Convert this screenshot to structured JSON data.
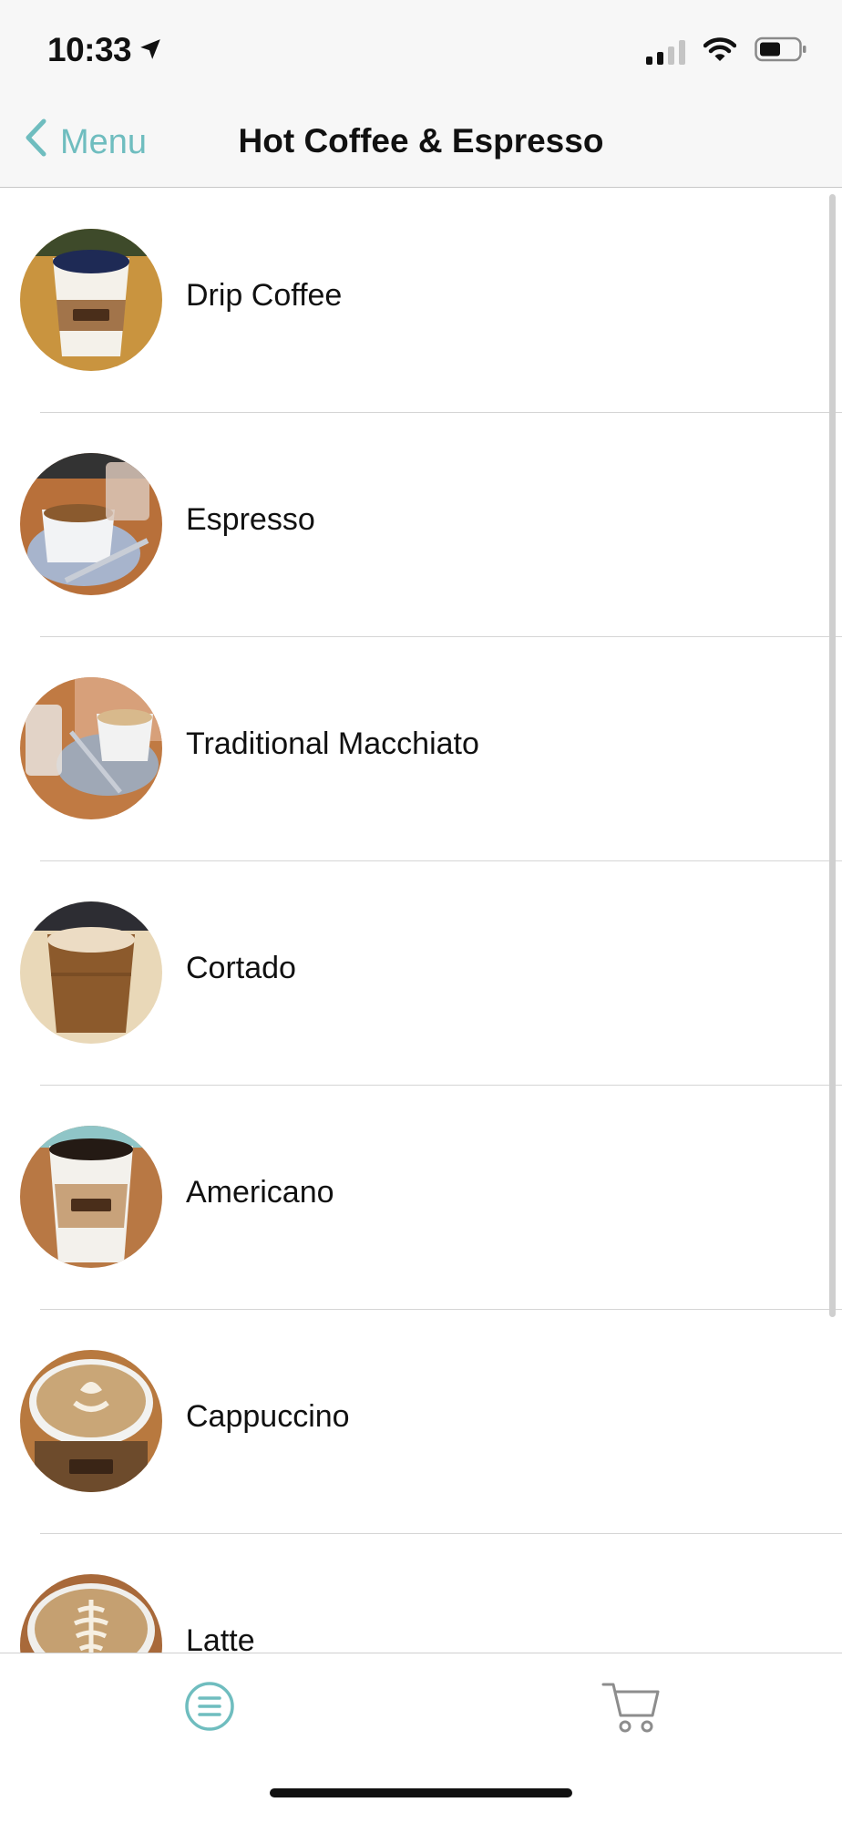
{
  "status_bar": {
    "time": "10:33"
  },
  "nav": {
    "back_label": "Menu",
    "title": "Hot Coffee & Espresso"
  },
  "items": [
    {
      "label": "Drip Coffee",
      "image": "drip-coffee-photo"
    },
    {
      "label": "Espresso",
      "image": "espresso-photo"
    },
    {
      "label": "Traditional Macchiato",
      "image": "macchiato-photo"
    },
    {
      "label": "Cortado",
      "image": "cortado-photo"
    },
    {
      "label": "Americano",
      "image": "americano-photo"
    },
    {
      "label": "Cappuccino",
      "image": "cappuccino-photo"
    },
    {
      "label": "Latte",
      "image": "latte-photo"
    }
  ],
  "tab_bar": {
    "tabs": [
      {
        "icon": "menu-list-icon",
        "active": true
      },
      {
        "icon": "cart-icon",
        "active": false
      }
    ]
  },
  "colors": {
    "accent": "#6fbdbf",
    "text": "#111111",
    "nav_background": "#f7f7f7",
    "separator": "#d5d5d5"
  }
}
